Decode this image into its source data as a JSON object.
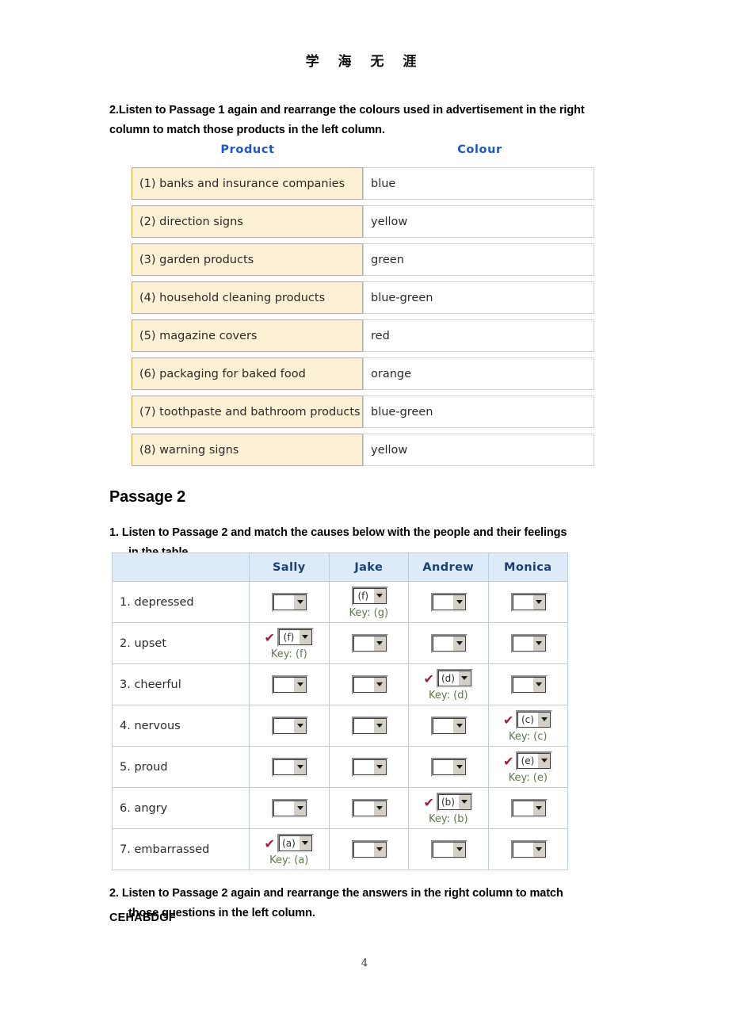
{
  "document": {
    "running_header": "学 海 无 涯",
    "page_number": "4"
  },
  "section1": {
    "instruction": "2.Listen to Passage 1 again and rearrange the colours used in advertisement in the right column to match those products in the left column.",
    "headers": {
      "left": "Product",
      "right": "Colour",
      "color": "#1a56cc"
    },
    "rows": [
      {
        "product": "(1) banks and insurance companies",
        "colour": "blue"
      },
      {
        "product": "(2) direction signs",
        "colour": "yellow"
      },
      {
        "product": "(3) garden products",
        "colour": "green"
      },
      {
        "product": "(4) household cleaning products",
        "colour": "blue-green"
      },
      {
        "product": "(5) magazine covers",
        "colour": "red"
      },
      {
        "product": "(6) packaging for baked food",
        "colour": "orange"
      },
      {
        "product": "(7) toothpaste and bathroom products",
        "colour": "blue-green"
      },
      {
        "product": "(8) warning signs",
        "colour": "yellow"
      }
    ],
    "style": {
      "product_bg": "#fdf1d5",
      "product_border": "#ddab3c",
      "colour_bg": "#ffffff",
      "colour_border": "#c6d6ea"
    }
  },
  "section2": {
    "title": "Passage 2",
    "instruction_main": "1. Listen to Passage 2 and match the causes below with the people and their feelings",
    "instruction_cont": "in the table.",
    "table": {
      "columns": [
        "",
        "Sally",
        "Jake",
        "Andrew",
        "Monica"
      ],
      "header_bg": "#dcebf7",
      "header_color": "#1b3f73",
      "border_color": "#b7cee4",
      "tick_color": "#9d1f36",
      "key_color": "#5d7a4a",
      "rows": [
        {
          "label": "1. depressed",
          "cells": [
            {
              "value": "",
              "key": "",
              "correct": false
            },
            {
              "value": "(f)",
              "key": "Key: (g)",
              "correct": false
            },
            {
              "value": "",
              "key": "",
              "correct": false
            },
            {
              "value": "",
              "key": "",
              "correct": false
            }
          ]
        },
        {
          "label": "2. upset",
          "cells": [
            {
              "value": "(f)",
              "key": "Key: (f)",
              "correct": true
            },
            {
              "value": "",
              "key": "",
              "correct": false
            },
            {
              "value": "",
              "key": "",
              "correct": false
            },
            {
              "value": "",
              "key": "",
              "correct": false
            }
          ]
        },
        {
          "label": "3. cheerful",
          "cells": [
            {
              "value": "",
              "key": "",
              "correct": false
            },
            {
              "value": "",
              "key": "",
              "correct": false
            },
            {
              "value": "(d)",
              "key": "Key: (d)",
              "correct": true
            },
            {
              "value": "",
              "key": "",
              "correct": false
            }
          ]
        },
        {
          "label": "4. nervous",
          "cells": [
            {
              "value": "",
              "key": "",
              "correct": false
            },
            {
              "value": "",
              "key": "",
              "correct": false
            },
            {
              "value": "",
              "key": "",
              "correct": false
            },
            {
              "value": "(c)",
              "key": "Key: (c)",
              "correct": true
            }
          ]
        },
        {
          "label": "5. proud",
          "cells": [
            {
              "value": "",
              "key": "",
              "correct": false
            },
            {
              "value": "",
              "key": "",
              "correct": false
            },
            {
              "value": "",
              "key": "",
              "correct": false
            },
            {
              "value": "(e)",
              "key": "Key: (e)",
              "correct": true
            }
          ]
        },
        {
          "label": "6. angry",
          "cells": [
            {
              "value": "",
              "key": "",
              "correct": false
            },
            {
              "value": "",
              "key": "",
              "correct": false
            },
            {
              "value": "(b)",
              "key": "Key: (b)",
              "correct": true
            },
            {
              "value": "",
              "key": "",
              "correct": false
            }
          ]
        },
        {
          "label": "7. embarrassed",
          "cells": [
            {
              "value": "(a)",
              "key": "Key: (a)",
              "correct": true
            },
            {
              "value": "",
              "key": "",
              "correct": false
            },
            {
              "value": "",
              "key": "",
              "correct": false
            },
            {
              "value": "",
              "key": "",
              "correct": false
            }
          ]
        }
      ]
    },
    "instruction2_main": "2. Listen to Passage 2 again and rearrange the answers in the right column to match",
    "instruction2_cont": "those questions in the left column.",
    "answer": "CEHABDGF"
  }
}
